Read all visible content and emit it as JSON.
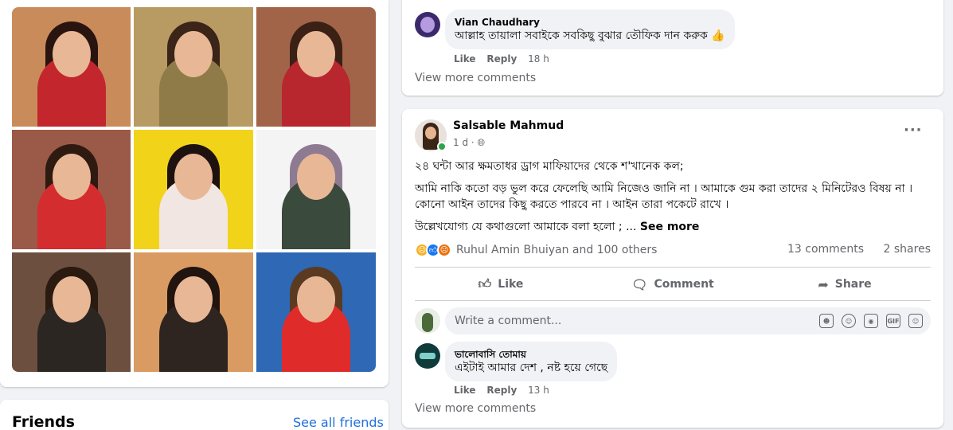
{
  "left": {
    "photos": [
      {
        "name": "photo-1",
        "bg": "#c98b5a",
        "hair": "#2a1410",
        "top": "#c3262d"
      },
      {
        "name": "photo-2",
        "bg": "#b89a63",
        "hair": "#3b2418",
        "top": "#8f7b48"
      },
      {
        "name": "photo-3",
        "bg": "#a16449",
        "hair": "#3a2015",
        "top": "#b8262e"
      },
      {
        "name": "photo-4",
        "bg": "#9a5a47",
        "hair": "#2f1a12",
        "top": "#d42d30"
      },
      {
        "name": "photo-5",
        "bg": "#f1d31a",
        "hair": "#1e1210",
        "top": "#f1e6e1"
      },
      {
        "name": "photo-6",
        "bg": "#f4f4f4",
        "hair": "#8e7b92",
        "top": "#3a4a3c"
      },
      {
        "name": "photo-7",
        "bg": "#6c4f3e",
        "hair": "#2a1a10",
        "top": "#2b2622"
      },
      {
        "name": "photo-8",
        "bg": "#d99b62",
        "hair": "#22140e",
        "top": "#2e2420"
      },
      {
        "name": "photo-9",
        "bg": "#2f68b5",
        "hair": "#5a3b22",
        "top": "#e02b2b"
      }
    ],
    "friends": {
      "title": "Friends",
      "see_all": "See all friends"
    }
  },
  "top_card": {
    "comment": {
      "author": "Vian Chaudhary",
      "text": "আল্লাহ তায়ালা সবাইকে সবকিছু বুঝার তৌফিক দান করুক 👍",
      "like": "Like",
      "reply": "Reply",
      "time": "18 h"
    },
    "view_more": "View more comments"
  },
  "post": {
    "author": "Salsable Mahmud",
    "meta": "1 d · ",
    "paragraphs": [
      "২৪ ঘন্টা আর ক্ষমতাধর ড্রাগ মাফিয়াদের থেকে শ'খানেক কল;",
      "আমি নাকি কতো বড় ভুল করে ফেলেছি আমি নিজেও জানি  না । আমাকে গুম করা তাদের ২ মিনিটেরও বিষয় না । কোনো আইন তাদের কিছু করতে পারবে না । আইন তারা পকেটে   রাখে ।",
      "উল্লেখযোগ্য যে কথাগুলো আমাকে বলা হলো ; ... "
    ],
    "see_more": "See more",
    "reaction_names": "Ruhul Amin Bhuiyan and 100 others",
    "comments_count": "13 comments",
    "shares_count": "2 shares",
    "actions": {
      "like": "Like",
      "comment": "Comment",
      "share": "Share"
    },
    "write_placeholder": "Write a comment...",
    "gif_label": "GIF",
    "comment": {
      "author": "ভালোবাসি তোমায়",
      "text": "এইটাই আমার দেশ , নষ্ট হয়ে গেছে",
      "like": "Like",
      "reply": "Reply",
      "time": "13 h"
    },
    "view_more": "View more comments"
  },
  "colors": {
    "link": "#216fdb",
    "muted": "#65676b",
    "like_blue": "#1877f2",
    "online": "#31a24c"
  }
}
